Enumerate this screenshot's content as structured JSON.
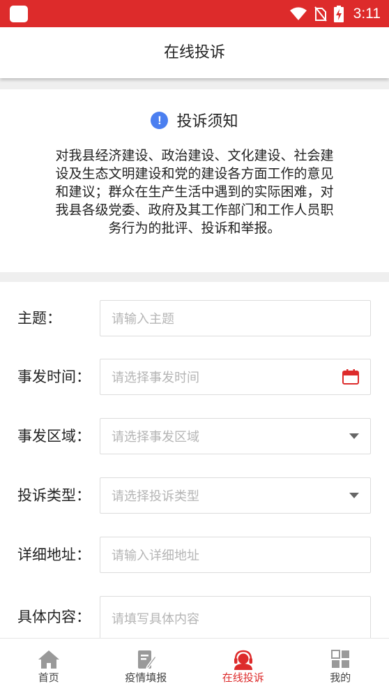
{
  "status_bar": {
    "time": "3:11"
  },
  "header": {
    "title": "在线投诉"
  },
  "notice": {
    "title": "投诉须知",
    "body": "对我县经济建设、政治建设、文化建设、社会建设及生态文明建设和党的建设各方面工作的意见和建议；群众在生产生活中遇到的实际困难，对我县各级党委、政府及其工作部门和工作人员职务行为的批评、投诉和举报。"
  },
  "form": {
    "fields": [
      {
        "label": "主题：",
        "placeholder": "请输入主题",
        "icon": "none"
      },
      {
        "label": "事发时间：",
        "placeholder": "请选择事发时间",
        "icon": "calendar-icon"
      },
      {
        "label": "事发区域：",
        "placeholder": "请选择事发区域",
        "icon": "dropdown-arrow-icon"
      },
      {
        "label": "投诉类型：",
        "placeholder": "请选择投诉类型",
        "icon": "dropdown-arrow-icon"
      },
      {
        "label": "详细地址：",
        "placeholder": "请输入详细地址",
        "icon": "none"
      },
      {
        "label": "具体内容：",
        "placeholder": "请填写具体内容",
        "icon": "none"
      }
    ]
  },
  "tabs": [
    {
      "label": "首页",
      "icon": "home-icon",
      "active": false
    },
    {
      "label": "疫情填报",
      "icon": "edit-document-icon",
      "active": false
    },
    {
      "label": "在线投诉",
      "icon": "customer-service-icon",
      "active": true
    },
    {
      "label": "我的",
      "icon": "grid-icon",
      "active": false
    }
  ],
  "colors": {
    "brand_red": "#dd2b2b",
    "info_blue": "#4b7ff0",
    "placeholder_gray": "#b5b5b5"
  }
}
